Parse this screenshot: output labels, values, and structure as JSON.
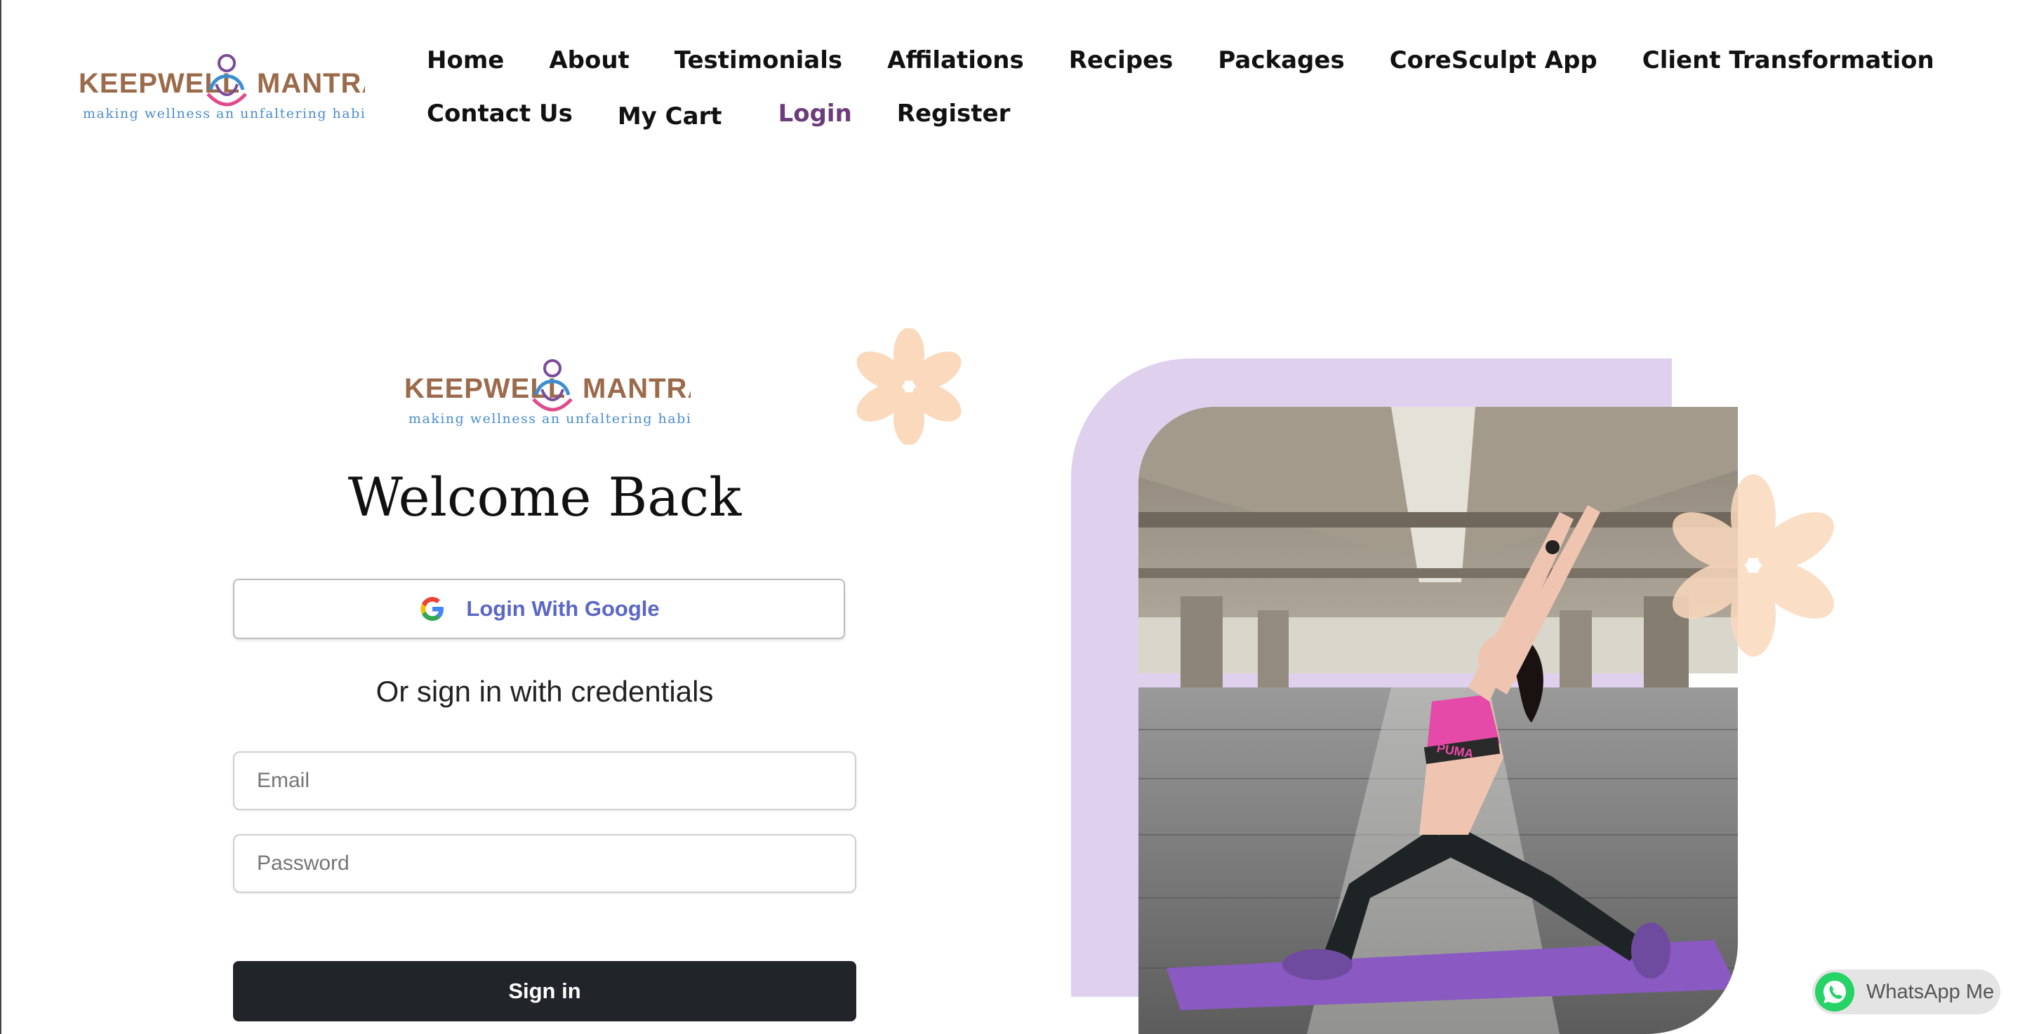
{
  "brand": {
    "name_left": "KEEPWELL",
    "name_right": "MANTRAS",
    "tagline": "making wellness an unfaltering habit"
  },
  "nav": {
    "row1": [
      "Home",
      "About",
      "Testimonials",
      "Affilations",
      "Recipes",
      "Packages",
      "CoreSculpt App",
      "Client Transformation"
    ],
    "contact": "Contact Us",
    "cart": "My Cart",
    "login": "Login",
    "register": "Register"
  },
  "login_form": {
    "title": "Welcome Back",
    "google_label": "Login With Google",
    "or_text": "Or sign in with credentials",
    "email_placeholder": "Email",
    "password_placeholder": "Password",
    "signin_label": "Sign in"
  },
  "photo_text": {
    "brand_on_top": "PUMA"
  },
  "whatsapp": {
    "label": "WhatsApp Me"
  },
  "colors": {
    "nav_active": "#6b3d7a",
    "google_label": "#5a67c8",
    "signin_bg": "#212428",
    "lilac_panel": "#dfd0ee",
    "flower": "#fbd9bd",
    "logo_brown": "#9b6a4b"
  },
  "icons": [
    "keepwell-logo-icon",
    "google-icon",
    "flower-icon",
    "whatsapp-icon"
  ]
}
